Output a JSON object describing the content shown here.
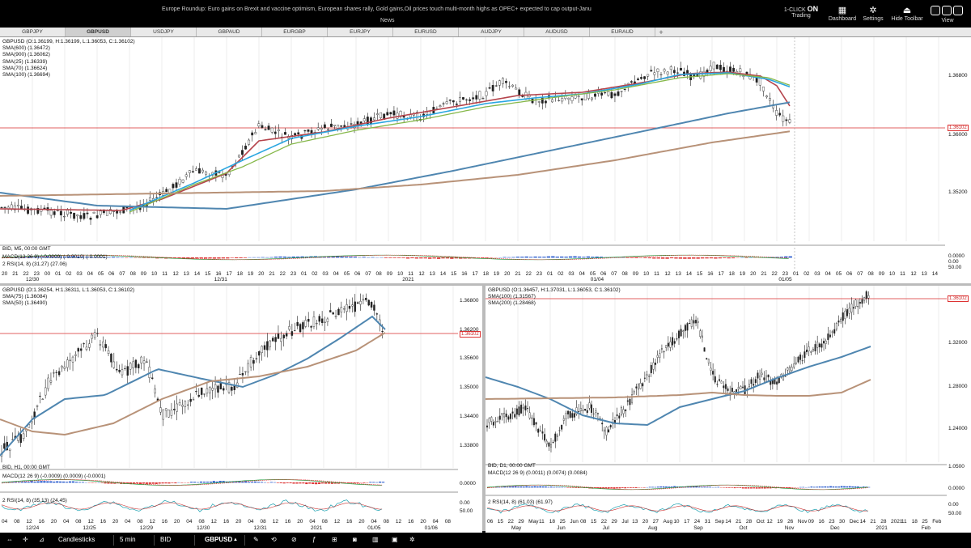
{
  "topbar": {
    "headline": "Europe Roundup: Euro gains  on Brexit and vaccine optimism, European shares rally, Gold gains,Oil prices touch multi-month highs as OPEC+ expected to cap output-Janu",
    "news_label": "News",
    "one_click_title": "1-CLICK",
    "one_click_state": "ON",
    "trading_label": "Trading",
    "dashboard_label": "Dashboard",
    "settings_label": "Settings",
    "hide_toolbar_label": "Hide Toolbar",
    "view_label": "View"
  },
  "tabs": [
    "GBPJPY",
    "GBPUSD",
    "USDJPY",
    "GBPAUD",
    "EURGBP",
    "EURJPY",
    "EURUSD",
    "AUDJPY",
    "AUDUSD",
    "EURAUD"
  ],
  "active_tab": "GBPUSD",
  "chart_top": {
    "legend": [
      "GBPUSD (O:1.36199, H:1.36199, L:1.36053, C:1.36102)",
      "SMA(600) (1.36472)",
      "SMA(900) (1.36062)",
      "SMA(25) (1.36339)",
      "SMA(70) (1.36624)",
      "SMA(100) (1.36694)"
    ],
    "bid_label": "BID, M5, 00:00 GMT",
    "macd_label": "MACD(12 26 9) (-0.0009) (-0.0010) (-0.0001)",
    "rsi_label": "2 RSI(14, 8) (31.27) (27.06)",
    "price_ticks": [
      "1.36800",
      "1.36000",
      "1.35200"
    ],
    "current_price": "1.36102",
    "macd_ticks": [
      "0.0000",
      "0.00",
      "50.00"
    ],
    "time_ticks": [
      "20",
      "21",
      "22",
      "23",
      "00",
      "01",
      "02",
      "03",
      "04",
      "05",
      "06",
      "07",
      "08",
      "09",
      "10",
      "11",
      "12",
      "13",
      "14",
      "15",
      "16",
      "17",
      "18",
      "19",
      "20",
      "21",
      "22",
      "23",
      "01",
      "02",
      "03",
      "04",
      "05",
      "06",
      "07",
      "08",
      "09",
      "10",
      "11",
      "12",
      "13",
      "14",
      "15",
      "16",
      "17",
      "18",
      "19",
      "20",
      "21",
      "22",
      "23",
      "01",
      "02",
      "03",
      "04",
      "05",
      "06",
      "07",
      "08",
      "09",
      "10",
      "11",
      "12",
      "13",
      "14",
      "15",
      "16",
      "17",
      "18",
      "19",
      "20",
      "21",
      "22",
      "23",
      "01",
      "02",
      "03",
      "04",
      "05",
      "06",
      "07",
      "08",
      "09",
      "10",
      "11",
      "12",
      "13",
      "14"
    ],
    "date_ticks": [
      "12/30",
      "12/31",
      "2021",
      "01/04",
      "01/05"
    ]
  },
  "chart_h1": {
    "legend": [
      "GBPUSD (O:1.36254, H:1.36311, L:1.36053, C:1.36102)",
      "SMA(75) (1.36084)",
      "SMA(50) (1.36490)"
    ],
    "bid_label": "BID, H1, 00:00 GMT",
    "macd_label": "MACD(12 26 9) (-0.0009) (0.0009) (-0.0001)",
    "rsi_label": "2 RSI(14, 8) (35.13) (24.45)",
    "price_ticks": [
      "1.36800",
      "1.36200",
      "1.35600",
      "1.35000",
      "1.34400",
      "1.33800"
    ],
    "current_price": "1.36102",
    "macd_ticks": [
      "0.0000",
      "0.00",
      "50.00"
    ],
    "time_ticks": [
      "04",
      "08",
      "12",
      "16",
      "20",
      "04",
      "08",
      "12",
      "16",
      "20",
      "04",
      "08",
      "12",
      "16",
      "20",
      "04",
      "08",
      "12",
      "16",
      "20",
      "04",
      "08",
      "12",
      "16",
      "20",
      "04",
      "08",
      "12",
      "16",
      "20",
      "04",
      "08",
      "12",
      "16",
      "20",
      "04",
      "08"
    ],
    "date_ticks": [
      "12/24",
      "12/25",
      "12/29",
      "12/30",
      "12/31",
      "2021",
      "01/05",
      "01/06"
    ]
  },
  "chart_d1": {
    "legend": [
      "GBPUSD (O:1.36457, H:1.37031, L:1.36053, C:1.36102)",
      "SMA(100) (1.31567)",
      "SMA(200) (1.28468)"
    ],
    "bid_label": "BID, D1, 00:00 GMT",
    "macd_label": "MACD(12 26 9) (0.0011) (0.0074) (0.0084)",
    "rsi_label": "2 RSI(14, 8) (61.03) (61.97)",
    "price_ticks": [
      "1.32000",
      "1.28000",
      "1.24000"
    ],
    "current_price": "1.36102",
    "side_ticks": [
      "1.0500",
      "0.0000",
      "0.00",
      "50.00"
    ],
    "time_ticks": [
      "06",
      "15",
      "22",
      "29",
      "May",
      "11",
      "18",
      "25",
      "Jun",
      "08",
      "15",
      "22",
      "29",
      "Jul",
      "13",
      "20",
      "27",
      "Aug",
      "10",
      "17",
      "24",
      "31",
      "Sep",
      "14",
      "21",
      "28",
      "Oct",
      "12",
      "19",
      "26",
      "Nov",
      "09",
      "16",
      "23",
      "30",
      "Dec",
      "14",
      "21",
      "28",
      "2021",
      "11",
      "18",
      "25",
      "Feb"
    ],
    "date_ticks": [
      "May",
      "Jun",
      "Jul",
      "Aug",
      "Sep",
      "Oct",
      "Nov",
      "Dec",
      "2021",
      "Feb"
    ]
  },
  "bottombar": {
    "chart_type": "Candlesticks",
    "timeframe": "5 min",
    "price_type": "BID",
    "symbol": "GBPUSD"
  },
  "colors": {
    "candle": "#222222",
    "sma_red": "#b5454d",
    "sma_cyan": "#2aa6e0",
    "sma_green": "#86b84a",
    "sma_blue": "#4f86b0",
    "sma_brown": "#b89278",
    "price_line": "#d92b2b"
  }
}
